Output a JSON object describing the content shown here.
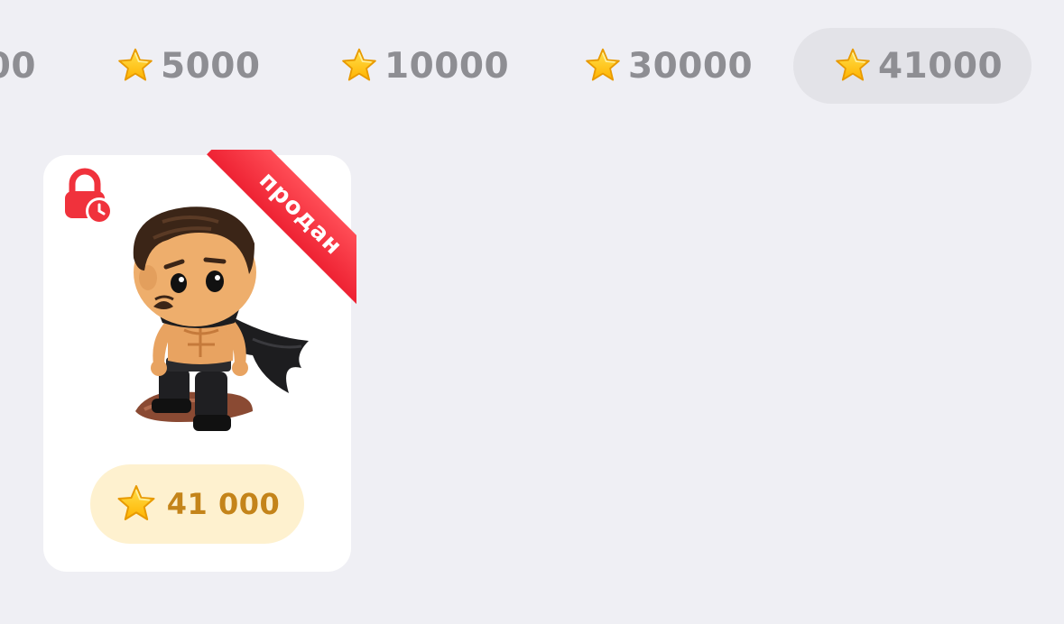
{
  "filters": {
    "items": [
      {
        "label": "00",
        "icon": "star-icon"
      },
      {
        "label": "5000",
        "icon": "star-icon"
      },
      {
        "label": "10000",
        "icon": "star-icon"
      },
      {
        "label": "30000",
        "icon": "star-icon"
      },
      {
        "label": "41000",
        "icon": "star-icon",
        "selected": true
      }
    ]
  },
  "gift_card": {
    "ribbon_label": "продан",
    "lock_icon": "locked-timer-icon",
    "image": "caped-man-sticker",
    "price_label": "41 000",
    "price_icon": "star-icon"
  },
  "colors": {
    "background": "#efeff4",
    "chip_text": "#8e8e93",
    "chip_active_bg": "#e3e3e8",
    "ribbon": "#ee2233",
    "price_bg": "#fef1cf",
    "price_text": "#c4841a",
    "star": "#ffc72c"
  }
}
